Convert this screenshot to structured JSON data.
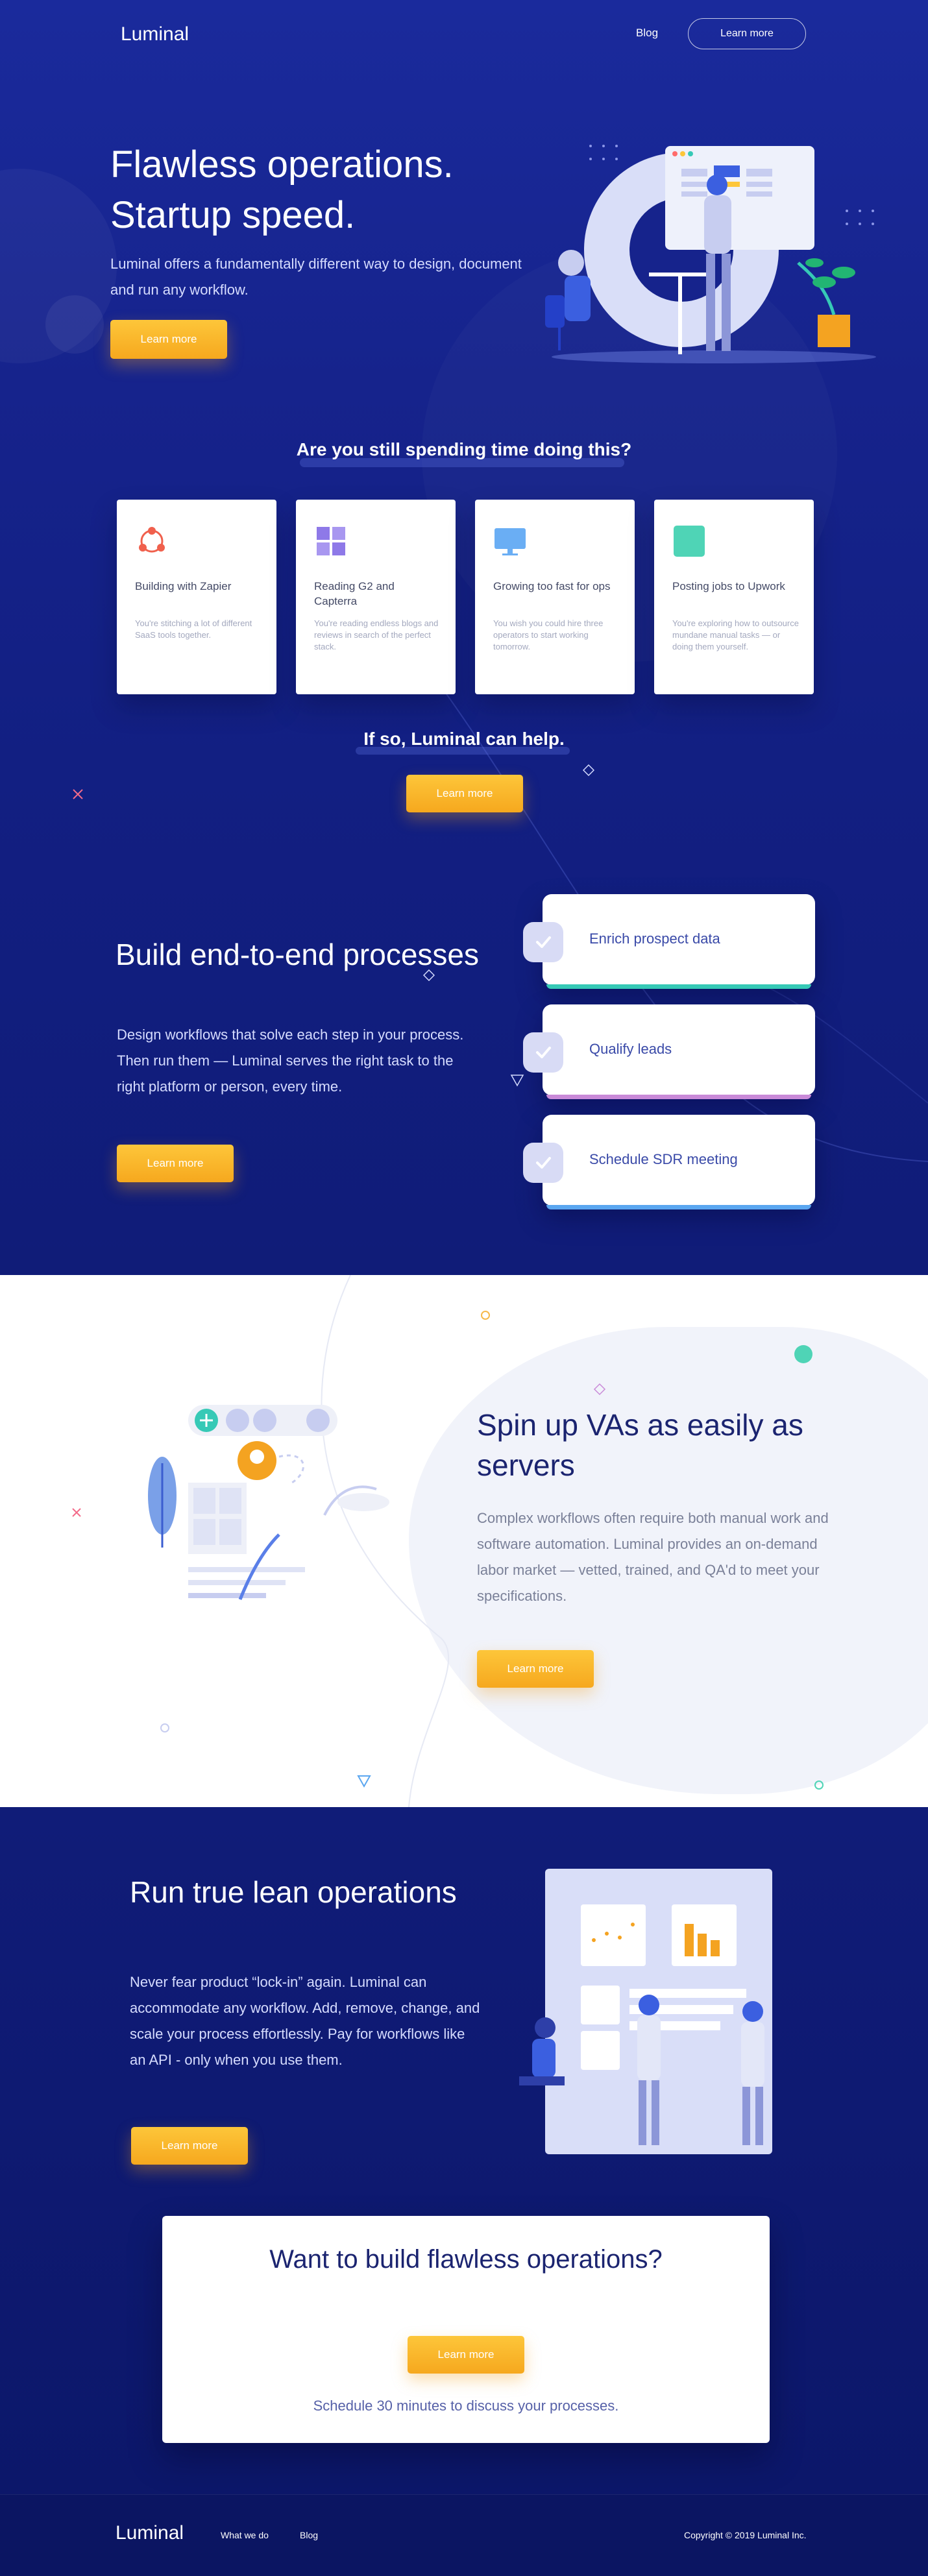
{
  "nav": {
    "logo": "Luminal",
    "blog": "Blog",
    "cta": "Learn more"
  },
  "hero": {
    "title_line1": "Flawless operations.",
    "title_line2": "Startup speed.",
    "subtitle": "Luminal offers a fundamentally different way to design, document and run any workflow.",
    "cta": "Learn more"
  },
  "pain": {
    "title": "Are you still spending time doing this?",
    "cards": [
      {
        "icon": "zapier-network-icon",
        "title": "Building with Zapier",
        "text": "You're stitching a lot of different SaaS tools together."
      },
      {
        "icon": "grid-icon",
        "title": "Reading G2 and Capterra",
        "text": "You're reading endless blogs and reviews in search of the perfect stack."
      },
      {
        "icon": "monitor-icon",
        "title": "Growing too fast for ops",
        "text": "You wish you could hire three operators to start working tomorrow."
      },
      {
        "icon": "square-icon",
        "title": "Posting jobs to Upwork",
        "text": "You're exploring how to outsource mundane manual tasks — or doing them yourself."
      }
    ],
    "help_title": "If so, Luminal can help.",
    "cta": "Learn more"
  },
  "build": {
    "title": "Build end-to-end processes",
    "desc": "Design workflows that solve each step in your process. Then run them — Luminal serves the right task to the right platform or person, every time.",
    "cta": "Learn more",
    "steps": [
      {
        "label": "Enrich prospect data",
        "color": "#36c9b6"
      },
      {
        "label": "Qualify leads",
        "color": "#c98ad8"
      },
      {
        "label": "Schedule SDR meeting",
        "color": "#5aa6f0"
      }
    ]
  },
  "va": {
    "title": "Spin up VAs as easily as servers",
    "desc": "Complex workflows often require both manual work and software automation. Luminal provides an on-demand labor market — vetted, trained, and QA'd to meet your specifications.",
    "cta": "Learn more"
  },
  "lean": {
    "title": "Run true lean operations",
    "desc": "Never fear product “lock-in” again. Luminal can accommodate any workflow. Add, remove, change, and scale your process effortlessly. Pay for workflows like an API - only when you use them.",
    "cta": "Learn more"
  },
  "final": {
    "title": "Want to build flawless operations?",
    "cta": "Learn more",
    "note": "Schedule 30 minutes to discuss your processes."
  },
  "footer": {
    "logo": "Luminal",
    "link1": "What we do",
    "link2": "Blog",
    "copyright": "Copyright © 2019 Luminal Inc."
  },
  "colors": {
    "navy": "#16238c",
    "amber": "#f6a81e",
    "heading_dark": "#1b2470"
  }
}
